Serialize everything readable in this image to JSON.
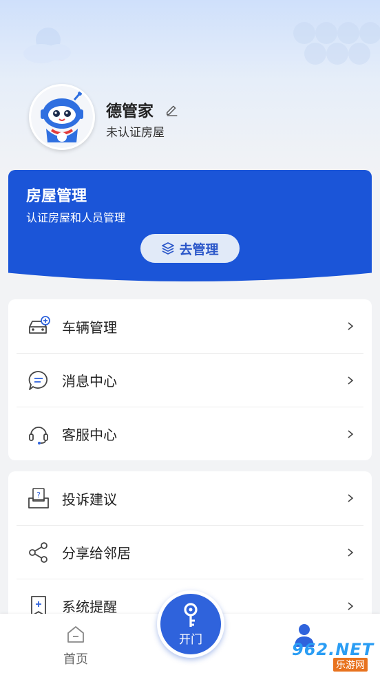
{
  "profile": {
    "name": "德管家",
    "status": "未认证房屋"
  },
  "house_card": {
    "title": "房屋管理",
    "subtitle": "认证房屋和人员管理",
    "button_label": "去管理",
    "color": "#1b55d8"
  },
  "menu_group_1": [
    {
      "label": "车辆管理",
      "icon": "car-icon"
    },
    {
      "label": "消息中心",
      "icon": "message-icon"
    },
    {
      "label": "客服中心",
      "icon": "headset-icon"
    }
  ],
  "menu_group_2": [
    {
      "label": "投诉建议",
      "icon": "complaint-icon"
    },
    {
      "label": "分享给邻居",
      "icon": "share-icon"
    },
    {
      "label": "系统提醒",
      "icon": "bookmark-icon"
    }
  ],
  "tab_bar": {
    "home_label": "首页",
    "open_door_label": "开门",
    "accent": "#2f63dc"
  },
  "watermark": {
    "brand": "962.NET",
    "sub": "乐游网"
  }
}
